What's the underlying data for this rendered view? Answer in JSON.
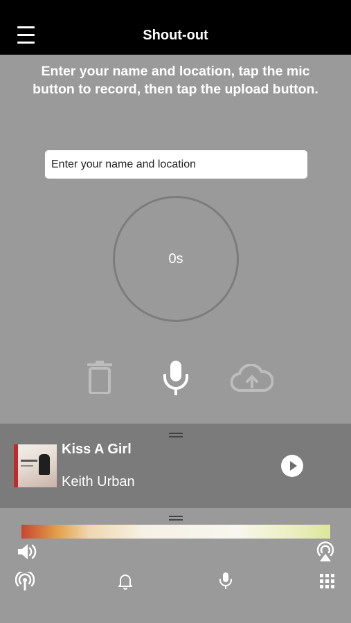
{
  "header": {
    "title": "Shout-out"
  },
  "instructions": "Enter your name and location, tap the mic button to record, then tap the upload button.",
  "name_field": {
    "placeholder": "Enter your name and location",
    "value": ""
  },
  "recorder": {
    "timer": "0s"
  },
  "controls": {
    "icons": [
      "trash-icon",
      "microphone-icon",
      "cloud-upload-icon"
    ]
  },
  "now_playing": {
    "title": "Kiss A Girl",
    "artist": "Keith Urban",
    "album_art_caption": "keith urban"
  },
  "bottom_bar": {
    "icons": [
      "volume-icon",
      "airplay-icon",
      "radio-stream-icon",
      "bell-icon",
      "microphone-nav-icon",
      "grid-menu-icon"
    ]
  },
  "colors": {
    "background": "#9a9a9a",
    "header": "#000000",
    "player": "#7b7b7b",
    "text": "#ffffff",
    "disabled_icon": "#bfbfbf"
  }
}
